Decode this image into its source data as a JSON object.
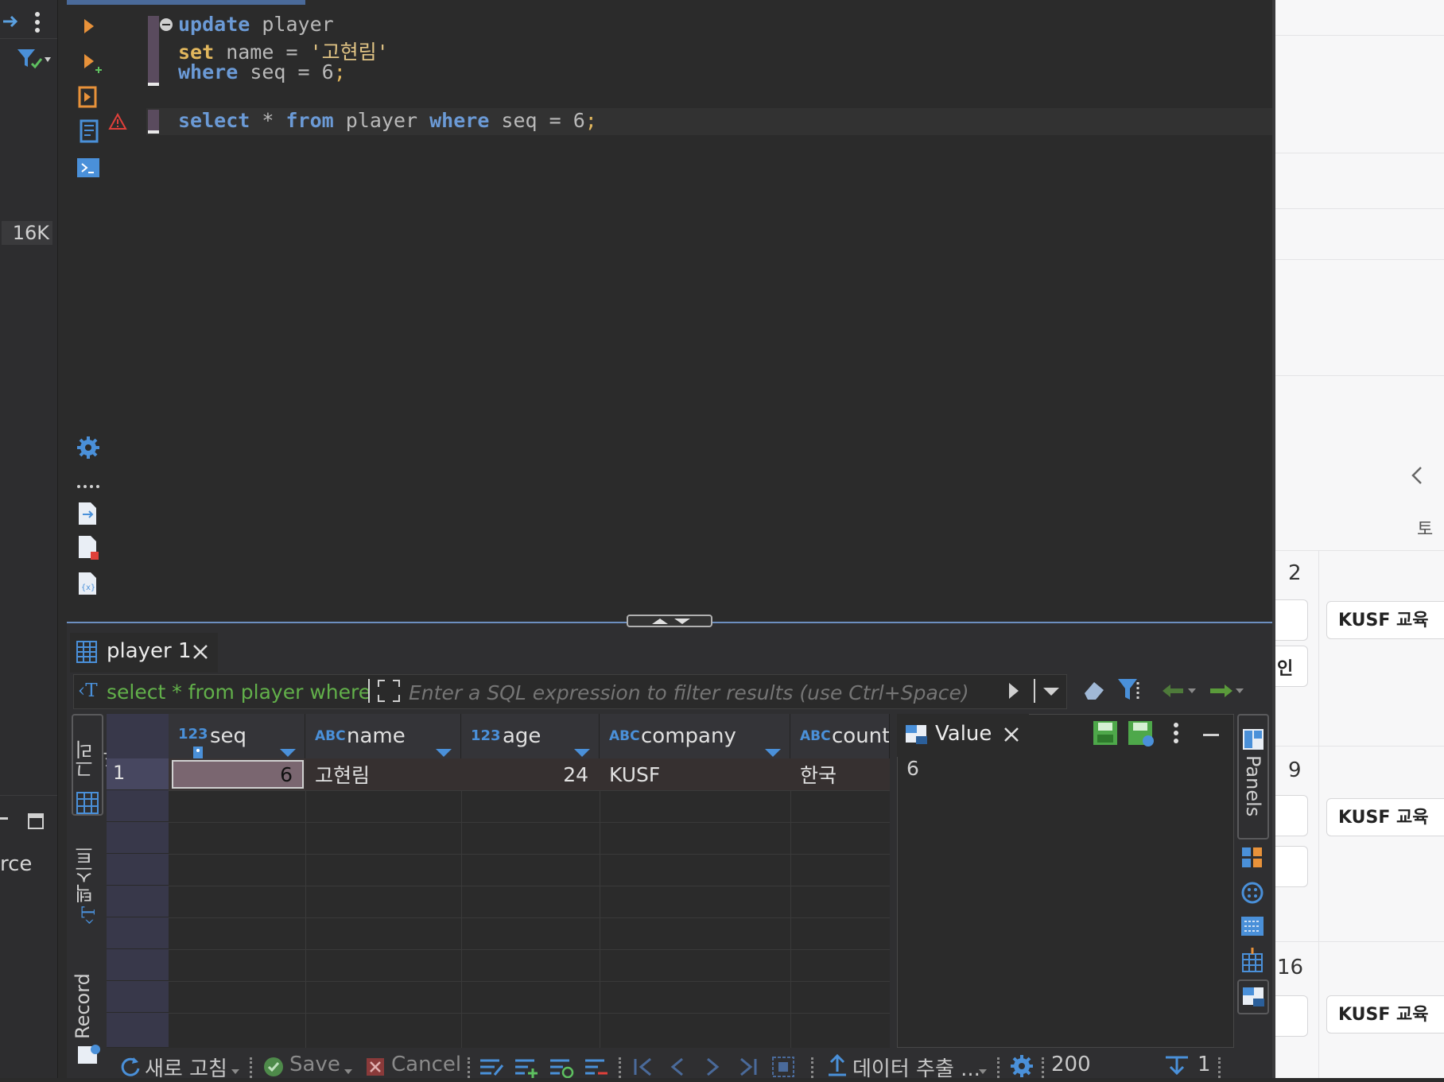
{
  "left_strip": {
    "size_badge": "16K",
    "fragment_text": "rce"
  },
  "editor": {
    "line1": {
      "kw": "update",
      "rest": " player"
    },
    "line2": {
      "kw": "set",
      "rest": " name = ",
      "str": "'고현림'"
    },
    "line3": {
      "kw": "where",
      "rest": " seq = 6",
      "punc": ";"
    },
    "line4": {
      "kw1": "select",
      "mid1": " * ",
      "kw2": "from",
      "mid2": " player ",
      "kw3": "where",
      "mid3": " seq = 6",
      "punc": ";"
    }
  },
  "result_tab": {
    "label": "player 1"
  },
  "filter": {
    "query_preview": "select * from player where",
    "placeholder": "Enter a SQL expression to filter results (use Ctrl+Space)"
  },
  "side_tabs": {
    "grid": "그리드",
    "text": "텍스트",
    "record": "Record"
  },
  "columns": [
    {
      "type": "123",
      "name": "seq"
    },
    {
      "type": "ABC",
      "name": "name"
    },
    {
      "type": "123",
      "name": "age"
    },
    {
      "type": "ABC",
      "name": "company"
    },
    {
      "type": "ABC",
      "name": "countr"
    }
  ],
  "rows": [
    {
      "num": "1",
      "seq": "6",
      "name": "고현림",
      "age": "24",
      "company": "KUSF",
      "country": "한국"
    }
  ],
  "value_panel": {
    "title": "Value",
    "value": "6"
  },
  "panels_label": "Panels",
  "bottom_toolbar": {
    "refresh": "새로 고침",
    "save": "Save",
    "cancel": "Cancel",
    "export": "데이터 추출 ...",
    "fetch_size": "200",
    "row_count": "1"
  },
  "webpage": {
    "day_label": "토",
    "partial_text": "인",
    "dates": [
      "2",
      "9",
      "16"
    ],
    "event_label": "KUSF 교육"
  },
  "colors": {
    "editor_bg": "#2b2b2b",
    "keyword_blue": "#6b9ad6",
    "keyword_gold": "#e2b75d",
    "accent_blue": "#4a90d9",
    "selected_cell": "#7a6670"
  }
}
